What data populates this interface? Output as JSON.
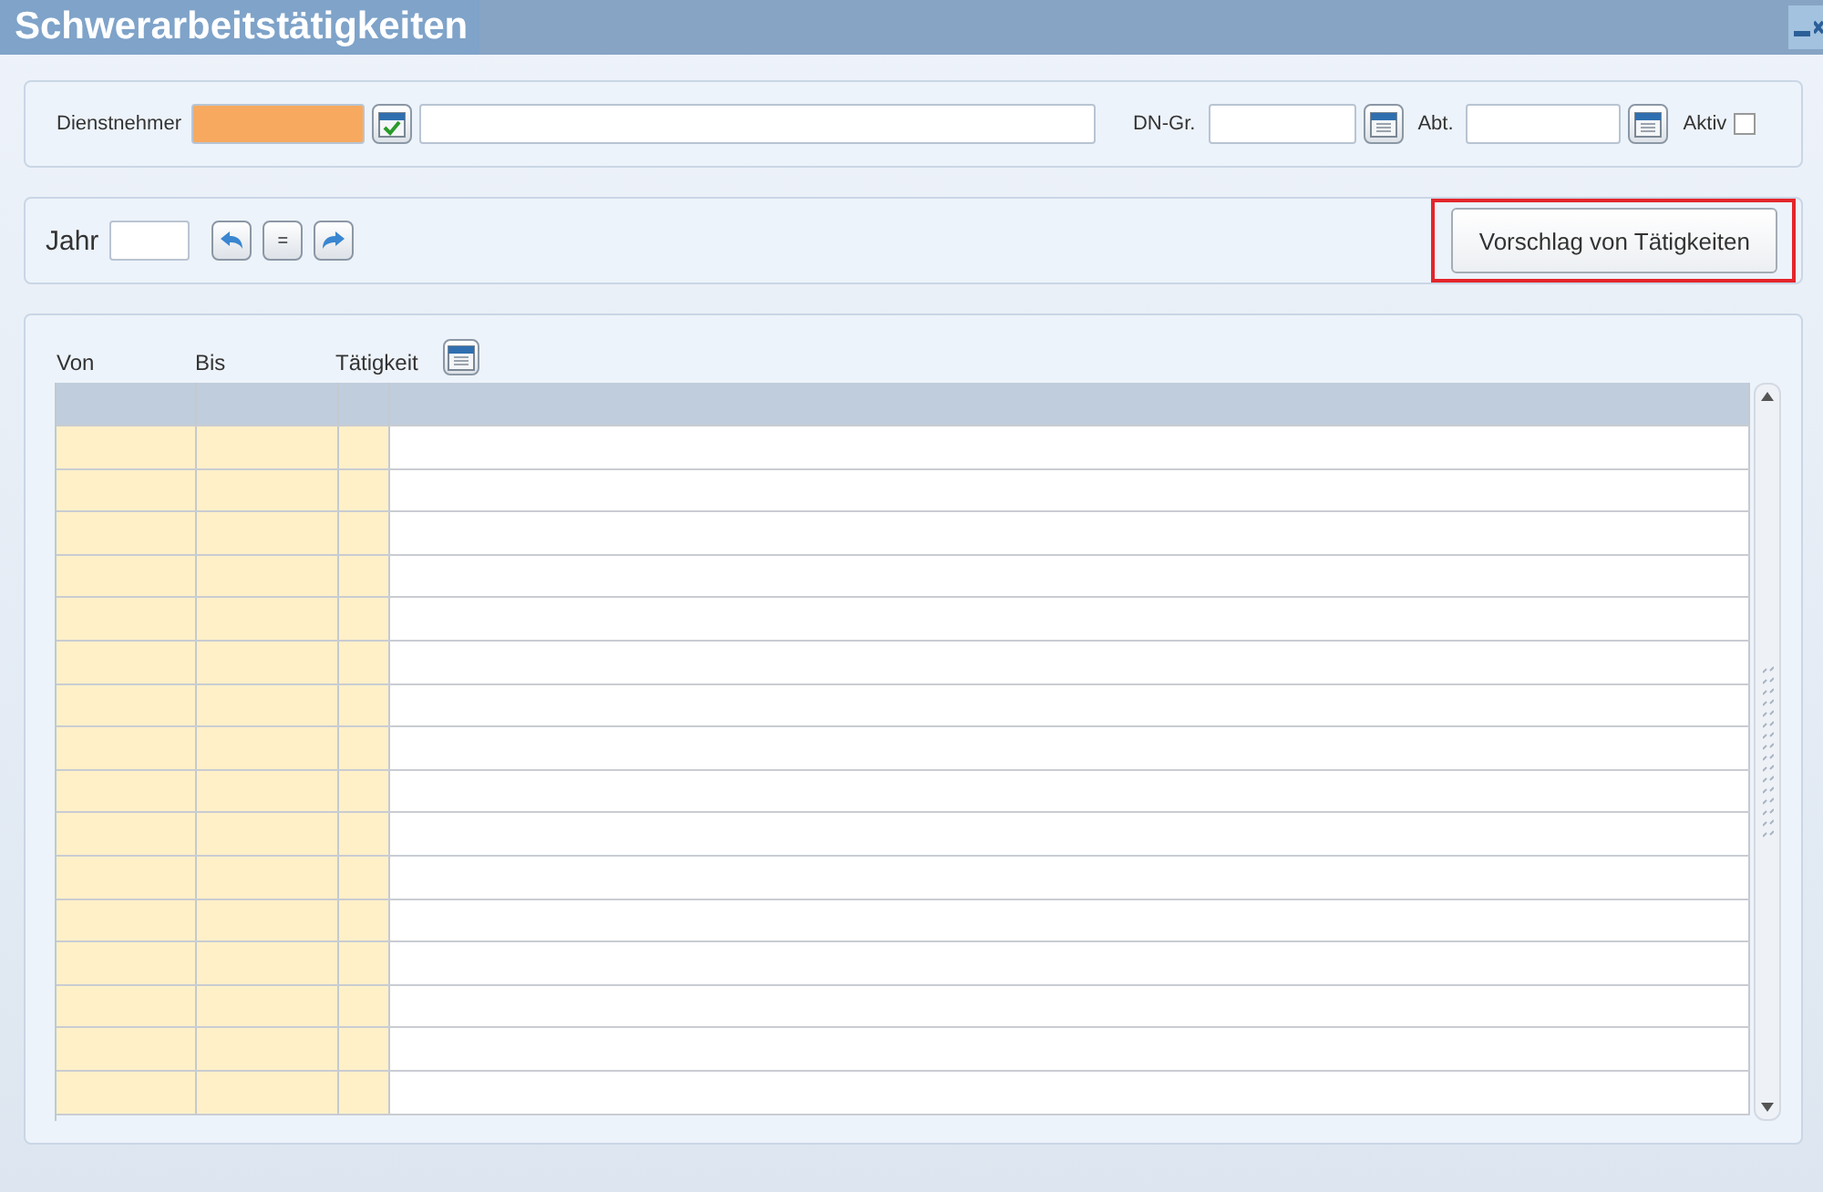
{
  "window": {
    "title": "Schwerarbeitstätigkeiten"
  },
  "filter": {
    "employee_label": "Dienstnehmer",
    "group_label": "DN-Gr.",
    "department_label": "Abt.",
    "active_label": "Aktiv",
    "active_checked": false
  },
  "year_bar": {
    "label": "Jahr",
    "equal_button": "=",
    "suggest_button": "Vorschlag von Tätigkeiten",
    "suggest_highlighted": true
  },
  "table": {
    "columns": [
      {
        "label": "Von",
        "kind": "key"
      },
      {
        "label": "Bis",
        "kind": "key"
      },
      {
        "label": "Tätigkeit",
        "kind": "key"
      },
      {
        "kind": "text"
      }
    ]
  }
}
